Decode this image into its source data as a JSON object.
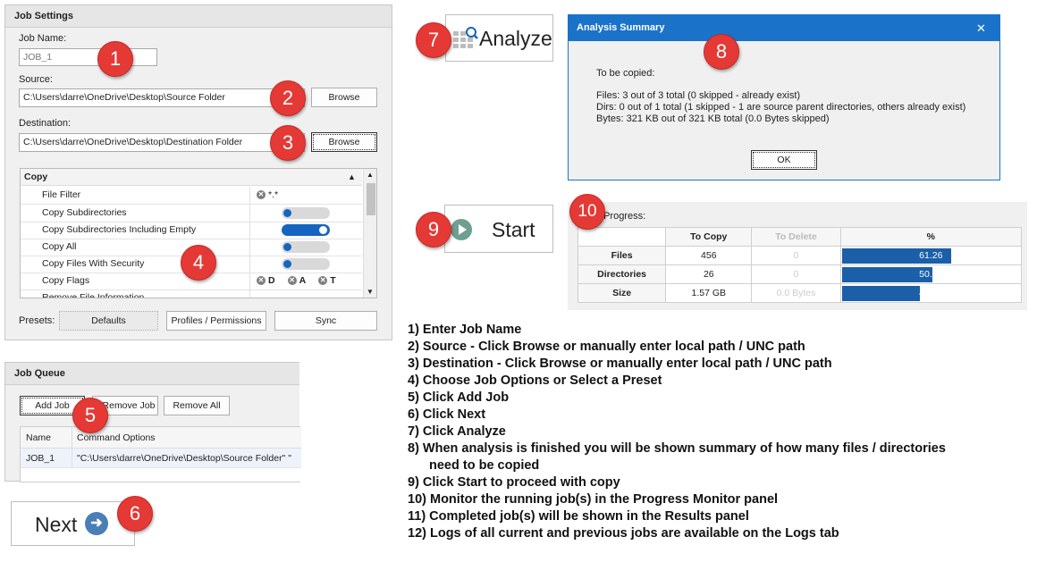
{
  "job_settings": {
    "title": "Job Settings",
    "job_name_label": "Job Name:",
    "job_name_value": "JOB_1",
    "source_label": "Source:",
    "source_value": "C:\\Users\\darre\\OneDrive\\Desktop\\Source Folder",
    "destination_label": "Destination:",
    "destination_value": "C:\\Users\\darre\\OneDrive\\Desktop\\Destination Folder",
    "browse_label": "Browse",
    "options_header": "Copy",
    "options": [
      {
        "name": "File Filter",
        "value": "*.*"
      },
      {
        "name": "Copy Subdirectories"
      },
      {
        "name": "Copy Subdirectories Including Empty"
      },
      {
        "name": "Copy All"
      },
      {
        "name": "Copy Files With Security"
      },
      {
        "name": "Copy Flags",
        "flags": [
          "D",
          "A",
          "T"
        ]
      },
      {
        "name": "Remove File Information"
      }
    ],
    "presets_label": "Presets:",
    "presets": [
      "Defaults",
      "Profiles / Permissions",
      "Sync"
    ]
  },
  "job_queue": {
    "title": "Job Queue",
    "add_job": "Add Job",
    "remove_job": "Remove Job",
    "remove_all": "Remove All",
    "col_name": "Name",
    "col_command": "Command Options",
    "row_name": "JOB_1",
    "row_command": "\"C:\\Users\\darre\\OneDrive\\Desktop\\Source Folder\" \""
  },
  "next_button": "Next",
  "analyze_button": "Analyze",
  "start_button": "Start",
  "analysis": {
    "title": "Analysis Summary",
    "close": "✕",
    "line1": "To be copied:",
    "files": "Files: 3 out of 3 total (0 skipped - already exist)",
    "dirs": "Dirs: 0 out of 1 total (1 skipped - 1 are source parent directories, others already exist)",
    "bytes": "Bytes: 321 KB out of 321 KB total (0.0 Bytes skipped)",
    "ok": "OK"
  },
  "progress": {
    "title": "All Job Progress:",
    "headers": [
      "To Copy",
      "To Delete",
      "%"
    ],
    "rows": [
      {
        "label": "Files",
        "to_copy": "456",
        "to_delete": "0",
        "pct": 61.26,
        "pct_text": "61.26"
      },
      {
        "label": "Directories",
        "to_copy": "26",
        "to_delete": "0",
        "pct": 50.94,
        "pct_text": "50.94"
      },
      {
        "label": "Size",
        "to_copy": "1.57 GB",
        "to_delete": "0.0 Bytes",
        "pct": 43.77,
        "pct_text": "43.77"
      }
    ]
  },
  "badges": [
    "1",
    "2",
    "3",
    "4",
    "5",
    "6",
    "7",
    "8",
    "9",
    "10"
  ],
  "steps": [
    "1) Enter Job Name",
    "2) Source - Click Browse or manually enter local path / UNC path",
    "3) Destination - Click Browse or manually enter local path / UNC path",
    "4) Choose Job Options or Select a Preset",
    "5) Click Add Job",
    "6) Click Next",
    "7) Click Analyze",
    "8) When analysis is finished you will be shown summary of how many files / directories",
    "need to be copied",
    "9) Click Start to proceed with copy",
    "10) Monitor the running job(s) in the Progress Monitor panel",
    "11) Completed job(s) will be shown in the Results panel",
    "12) Logs of all current and previous jobs are available on the Logs tab"
  ],
  "colors": {
    "accent": "#1565c0",
    "titlebar": "#1b73c9",
    "badge": "#e53935",
    "progress": "#1a5fa8"
  }
}
